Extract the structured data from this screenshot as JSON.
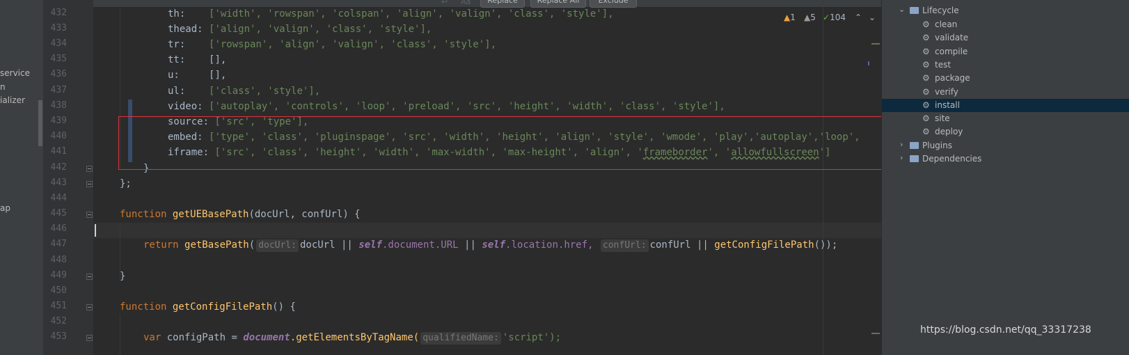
{
  "left_panel": {
    "items": [
      "service",
      "n",
      "ializer",
      "ap"
    ]
  },
  "find_bar": {
    "replace_label": "Replace",
    "replace_all_label": "Replace All",
    "exclude_label": "Exclude"
  },
  "inspections": {
    "warnings": "1",
    "weak_warnings": "5",
    "typos": "104"
  },
  "code": {
    "line_numbers": [
      "432",
      "433",
      "434",
      "435",
      "436",
      "437",
      "438",
      "439",
      "440",
      "441",
      "442",
      "443",
      "444",
      "445",
      "446",
      "447",
      "448",
      "449",
      "450",
      "451",
      "452",
      "453"
    ],
    "l432": {
      "key": "th:",
      "vals": "['width', 'rowspan', 'colspan', 'align', 'valign', 'class', 'style'],"
    },
    "l433": {
      "key": "thead:",
      "vals": "['align', 'valign', 'class', 'style'],"
    },
    "l434": {
      "key": "tr:",
      "vals": "['rowspan', 'align', 'valign', 'class', 'style'],"
    },
    "l435": {
      "key": "tt:",
      "vals": "[],"
    },
    "l436": {
      "key": "u:",
      "vals": "[],"
    },
    "l437": {
      "key": "ul:",
      "vals": "['class', 'style'],"
    },
    "l438": {
      "key": "video:",
      "vals": "['autoplay', 'controls', 'loop', 'preload', 'src', 'height', 'width', 'class', 'style'],"
    },
    "l439": {
      "key": "source:",
      "vals": "['src', 'type'],"
    },
    "l440": {
      "key": "embed:",
      "vals": "['type', 'class', 'pluginspage', 'src', 'width', 'height', 'align', 'style', 'wmode', 'play','autoplay','loop',"
    },
    "l441": {
      "key": "iframe:",
      "vals_a": "['src', 'class', 'height', 'width', 'max-width', 'max-height', 'align', '",
      "w1": "frameborder",
      "vals_b": "', '",
      "w2": "allowfullscreen",
      "vals_c": "']"
    },
    "l442": "}",
    "l443": "};",
    "l445": {
      "kw": "function",
      "name": "getUEBasePath",
      "params": "(docUrl, confUrl) {"
    },
    "l447": {
      "kw": "return",
      "fn": "getBasePath",
      "hint1": "docUrl:",
      "arg1": "docUrl ||",
      "self1": "self",
      "prop1": ".document.",
      "url": "URL",
      "self2": "self",
      "prop2": ".location.href,",
      "hint2": "confUrl:",
      "arg2": "confUrl ||",
      "fn2": "getConfigFilePath",
      "tail": "());"
    },
    "l449": "}",
    "l451": {
      "kw": "function",
      "name": "getConfigFilePath",
      "params": "() {"
    },
    "l453": {
      "kw": "var",
      "var": "configPath =",
      "obj": "document",
      "fn": ".getElementsByTagName(",
      "hint": "qualifiedName:",
      "arg": "'script');"
    }
  },
  "maven": {
    "lifecycle_label": "Lifecycle",
    "goals": [
      "clean",
      "validate",
      "compile",
      "test",
      "package",
      "verify",
      "install",
      "site",
      "deploy"
    ],
    "selected": "install",
    "plugins_label": "Plugins",
    "dependencies_label": "Dependencies"
  },
  "watermark": "https://blog.csdn.net/qq_33317238"
}
